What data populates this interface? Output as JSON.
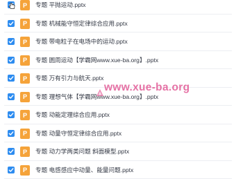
{
  "icons": {
    "checkbox": "checkmark-icon",
    "file": "ppt-file-icon",
    "cursor": "hand-pointer-icon"
  },
  "colors": {
    "checkbox": "#2d8cf0",
    "ppt_icon": "#f5a33a",
    "watermark": "#dc3c82",
    "text": "#333844"
  },
  "file_icon_letter": "P",
  "files": [
    {
      "name": "专题 平抛运动.pptx",
      "checked": true
    },
    {
      "name": "专题 机械能守恒定律综合应用.pptx",
      "checked": true
    },
    {
      "name": "专题 带电粒子在电场中的运动.pptx",
      "checked": true
    },
    {
      "name": "专题 圆周运动【学霸网www.xue-ba.org】.pptx",
      "checked": true
    },
    {
      "name": "专题 万有引力与航天.pptx",
      "checked": true
    },
    {
      "name": "专题 理想气体【学霸网www.xue-ba.org】.pptx",
      "checked": true
    },
    {
      "name": "专题 动能定理综合应用.pptx",
      "checked": true
    },
    {
      "name": "专题 动量守恒定律综合应用.pptx",
      "checked": true
    },
    {
      "name": "专题 动力学两类问题 斜面模型.pptx",
      "checked": true
    },
    {
      "name": "专题 电感感应中动量、能量问题.pptx",
      "checked": true
    }
  ],
  "watermark": {
    "text": "www.xue-ba.org"
  }
}
